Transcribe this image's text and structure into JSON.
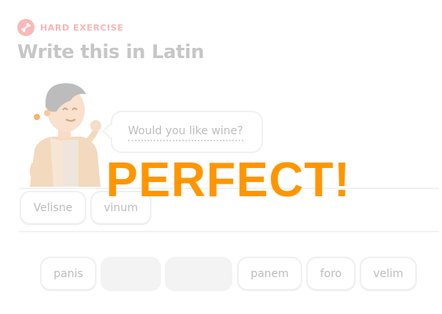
{
  "badge": {
    "icon": "dumbbell-icon",
    "label": "HARD EXERCISE"
  },
  "title": "Write this in Latin",
  "character": {
    "icon": "character-avatar"
  },
  "prompt": "Would you like wine?",
  "answer_tiles": [
    "Velisne",
    "vinum"
  ],
  "word_bank": [
    {
      "label": "panis",
      "used": false
    },
    {
      "label": "",
      "used": true
    },
    {
      "label": "",
      "used": true
    },
    {
      "label": "panem",
      "used": false
    },
    {
      "label": "foro",
      "used": false
    },
    {
      "label": "velim",
      "used": false
    }
  ],
  "feedback": "PERFECT!",
  "colors": {
    "badge": "#f9b9b9",
    "title": "#c6c6c6",
    "feedback": "#ff9600",
    "tile_border": "#f0f0f0",
    "used_tile": "#f3f3f3"
  }
}
